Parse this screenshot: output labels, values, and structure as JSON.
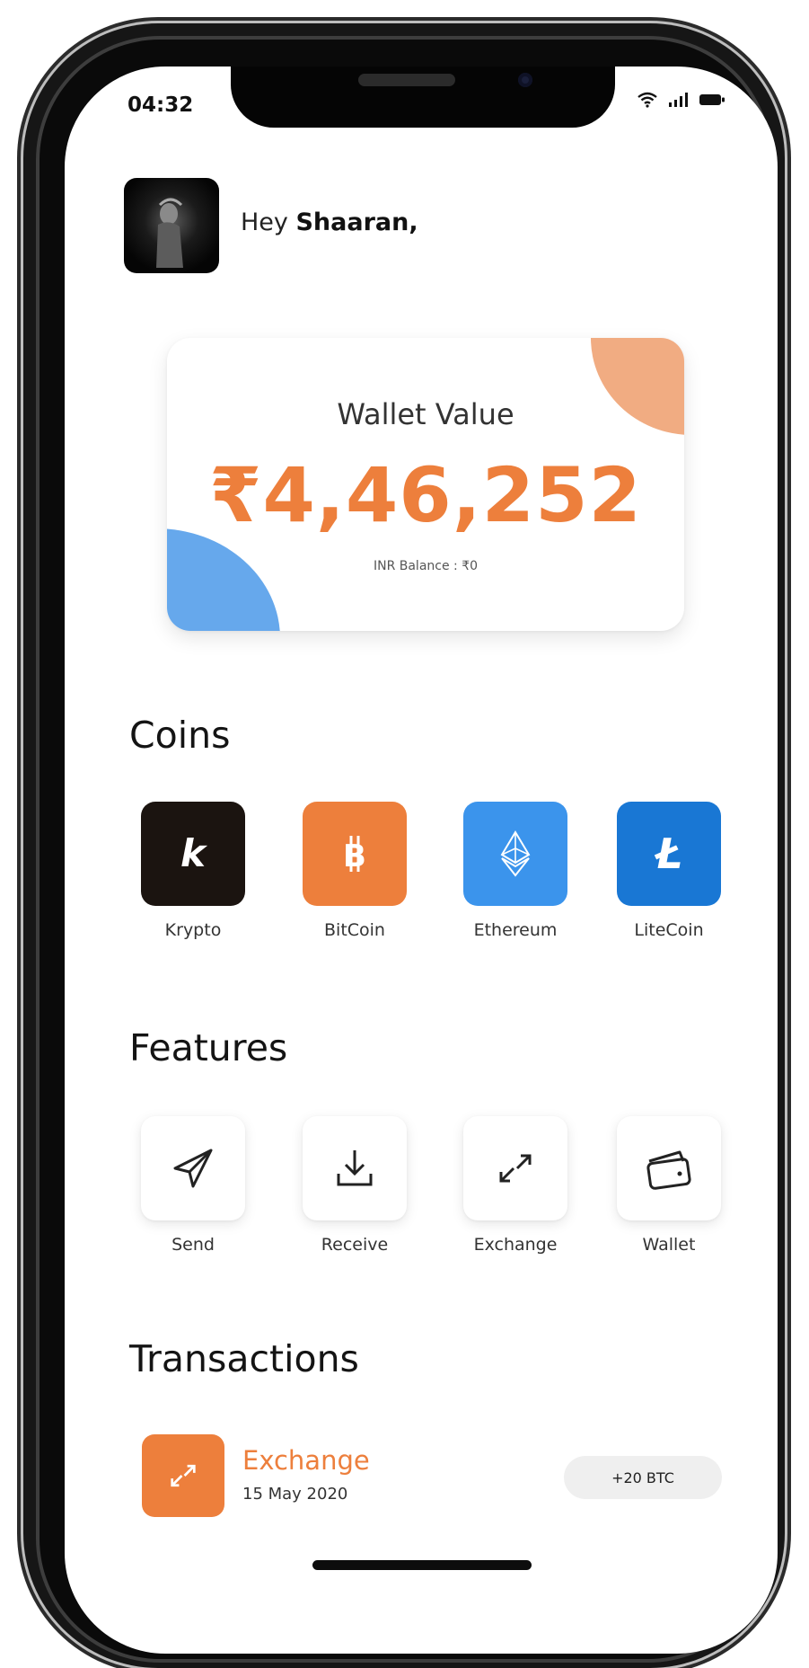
{
  "status_bar": {
    "time": "04:32"
  },
  "header": {
    "greeting_prefix": "Hey ",
    "user_name": "Shaaran,"
  },
  "wallet": {
    "label": "Wallet Value",
    "amount": "₹4,46,252",
    "inr_balance": "INR Balance : ₹0"
  },
  "coins": {
    "title": "Coins",
    "items": [
      {
        "label": "Krypto",
        "glyph": "k",
        "color": "#1b1410",
        "icon": "krypto-icon"
      },
      {
        "label": "BitCoin",
        "glyph": "B",
        "color": "#ed7f3c",
        "icon": "bitcoin-icon"
      },
      {
        "label": "Ethereum",
        "glyph": "",
        "color": "#3b94ec",
        "icon": "ethereum-icon"
      },
      {
        "label": "LiteCoin",
        "glyph": "Ł",
        "color": "#1977d4",
        "icon": "litecoin-icon"
      }
    ]
  },
  "features": {
    "title": "Features",
    "items": [
      {
        "label": "Send",
        "icon": "send-icon"
      },
      {
        "label": "Receive",
        "icon": "receive-icon"
      },
      {
        "label": "Exchange",
        "icon": "exchange-icon"
      },
      {
        "label": "Wallet",
        "icon": "wallet-icon"
      }
    ]
  },
  "transactions": {
    "title": "Transactions",
    "items": [
      {
        "title": "Exchange",
        "date": "15 May 2020",
        "amount": "+20 BTC",
        "icon": "exchange-icon"
      }
    ]
  },
  "colors": {
    "accent": "#ed7f3c",
    "card_peach": "#f1ac82",
    "card_blue": "#66a8ec"
  }
}
